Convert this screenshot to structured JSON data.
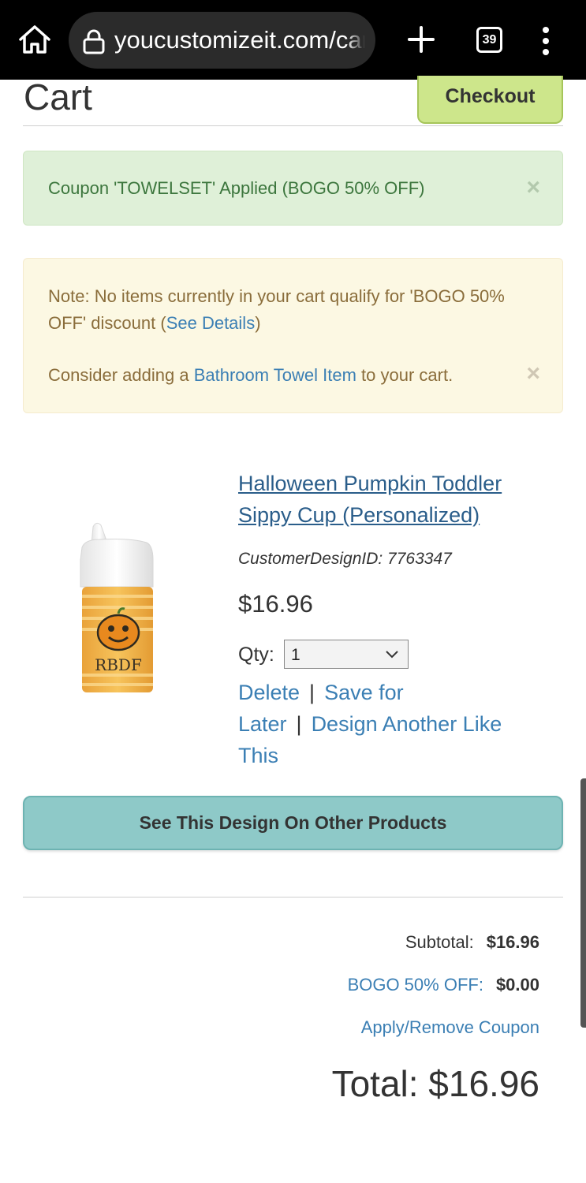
{
  "browser": {
    "url": "youcustomizeit.com/cart",
    "tab_count": "39",
    "icons": [
      "home-icon",
      "lock-icon",
      "plus-icon",
      "tabs-icon",
      "more-vertical-icon"
    ]
  },
  "header": {
    "title": "Cart",
    "checkout_label": "Checkout"
  },
  "alerts": {
    "coupon_applied": "Coupon 'TOWELSET' Applied (BOGO 50% OFF)",
    "note_prefix": "Note: No items currently in your cart qualify for 'BOGO 50% OFF' discount (",
    "note_link": "See Details",
    "note_suffix": ")",
    "consider_prefix": "Consider adding a ",
    "consider_link": "Bathroom Towel Item",
    "consider_suffix": " to your cart.",
    "close_glyph": "×"
  },
  "product": {
    "name": "Halloween Pumpkin Toddler Sippy Cup (Personalized)",
    "design_id": "CustomerDesignID: 7763347",
    "price": "$16.96",
    "qty_label": "Qty:",
    "qty_value": "1",
    "image_text": "RBDF",
    "actions": {
      "delete": "Delete",
      "save_for_later": "Save for Later",
      "design_another": "Design Another Like This",
      "separator": "|"
    }
  },
  "other_products_label": "See This Design On Other Products",
  "summary": {
    "subtotal_label": "Subtotal:",
    "subtotal_value": "$16.96",
    "discount_label": "BOGO 50% OFF:",
    "discount_value": "$0.00",
    "coupon_link": "Apply/Remove Coupon",
    "total": "Total: $16.96"
  },
  "colors": {
    "checkout_bg": "#cde68b",
    "success_bg": "#dff0d8",
    "warning_bg": "#fcf8e3",
    "link": "#3b7fb4",
    "teal_button": "#8ec9c8"
  }
}
